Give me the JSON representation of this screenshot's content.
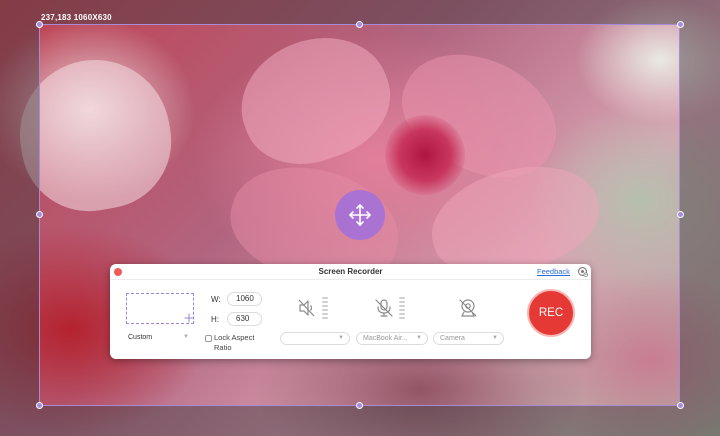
{
  "overlay": {
    "size_label": "237,183 1060X630"
  },
  "panel": {
    "title": "Screen Recorder",
    "feedback_label": "Feedback",
    "region_mode": "Custom",
    "width_label": "W:",
    "width_value": "1060",
    "height_label": "H:",
    "height_value": "630",
    "lock_label": "Lock Aspect Ratio",
    "speaker_device": "",
    "mic_device": "MacBook Air...",
    "camera_device": "Camera",
    "rec_label": "REC"
  },
  "colors": {
    "accent": "#a98be0",
    "rec": "#e53935",
    "feedback_link": "#2b6cd3"
  },
  "icons": [
    "move-icon",
    "settings-icon",
    "speaker-muted-icon",
    "mic-muted-icon",
    "camera-off-icon",
    "close-icon",
    "chevron-down-icon"
  ]
}
